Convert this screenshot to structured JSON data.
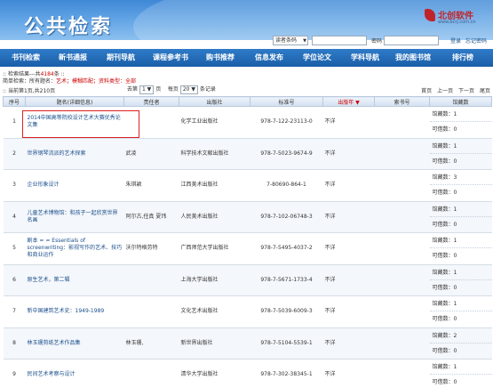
{
  "header": {
    "title": "公共检索",
    "logo_brand": "北创软件",
    "logo_url": "www.bcrj.com.cn"
  },
  "login": {
    "type_select": "读者条码",
    "password_label": "密码",
    "login_link": "登录",
    "forgot_link": "忘记密码"
  },
  "nav": {
    "items": [
      "书刊检索",
      "新书通报",
      "期刊导航",
      "课程参考书",
      "购书推荐",
      "信息发布",
      "学位论文",
      "学科导航",
      "我的图书馆",
      "排行榜"
    ]
  },
  "results": {
    "prefix": ":: 检索结果---共",
    "count": "4184",
    "suffix": "条 ::",
    "condition_label": "简单检索：所有题名：",
    "condition_value": "艺术；模糊匹配；资料类型：全部"
  },
  "pager": {
    "page_info": ":: 当前第1页,共210页",
    "goto_label": "去第",
    "goto_value": "1",
    "page_unit": "页",
    "per_page_label": "每页",
    "per_page_value": "20",
    "per_page_unit": "条记录",
    "first": "首页",
    "prev": "上一页",
    "next": "下一页",
    "last": "尾页"
  },
  "table": {
    "columns": [
      "序号",
      "题名(详细信息)",
      "责任者",
      "出版社",
      "标准号",
      "出版年 ▼",
      "索书号",
      "馆藏数"
    ],
    "rows": [
      {
        "no": "1",
        "title": "2014中国高等院校设计艺术大赛优秀论文集",
        "author": "",
        "publisher": "化学工业出版社",
        "isbn": "978-7-122-23113-0",
        "year": "不详",
        "callno": "",
        "held": "馆藏数：1",
        "avail": "可借数：0"
      },
      {
        "no": "2",
        "title": "世界钢琴流派的艺术探索",
        "author": "武凌",
        "publisher": "科学技术文献出版社",
        "isbn": "978-7-5023-9674-9",
        "year": "不详",
        "callno": "",
        "held": "馆藏数：1",
        "avail": "可借数：0"
      },
      {
        "no": "3",
        "title": "企业形象设计",
        "author": "朱琪颖",
        "publisher": "江西美术出版社",
        "isbn": "7-80690-864-1",
        "year": "不详",
        "callno": "",
        "held": "馆藏数：3",
        "avail": "可借数：0"
      },
      {
        "no": "4",
        "title": "儿童艺术博物馆：和孩子一起欣赏世界名画",
        "author": "阿尔古,任真 夏玮",
        "publisher": "人民美术出版社",
        "isbn": "978-7-102-06748-3",
        "year": "不详",
        "callno": "",
        "held": "馆藏数：1",
        "avail": "可借数：0"
      },
      {
        "no": "5",
        "title": "剧本 = = Essentials of screenwriting：影视写作的艺术、技巧和商业运作",
        "author": "沃尔特格劳特",
        "publisher": "广西师范大学出版社",
        "isbn": "978-7-5495-4037-2",
        "year": "不详",
        "callno": "",
        "held": "馆藏数：1",
        "avail": "可借数：0"
      },
      {
        "no": "6",
        "title": "原生艺术，第二辑",
        "author": "",
        "publisher": "上海大学出版社",
        "isbn": "978-7-5671-1733-4",
        "year": "不详",
        "callno": "",
        "held": "馆藏数：1",
        "avail": "可借数：0"
      },
      {
        "no": "7",
        "title": "新中国建筑艺术史：1949-1989",
        "author": "",
        "publisher": "文化艺术出版社",
        "isbn": "978-7-5039-6009-3",
        "year": "不详",
        "callno": "",
        "held": "馆藏数：1",
        "avail": "可借数：0"
      },
      {
        "no": "8",
        "title": "林玉珊剪纸艺术作品集",
        "author": "林玉珊,",
        "publisher": "新世界出版社",
        "isbn": "978-7-5104-5539-1",
        "year": "不详",
        "callno": "",
        "held": "馆藏数：2",
        "avail": "可借数：0"
      },
      {
        "no": "9",
        "title": "民间艺术考察与设计",
        "author": "",
        "publisher": "清华大学出版社",
        "isbn": "978-7-302-38345-1",
        "year": "不详",
        "callno": "",
        "held": "馆藏数：1",
        "avail": "可借数：0"
      }
    ]
  }
}
